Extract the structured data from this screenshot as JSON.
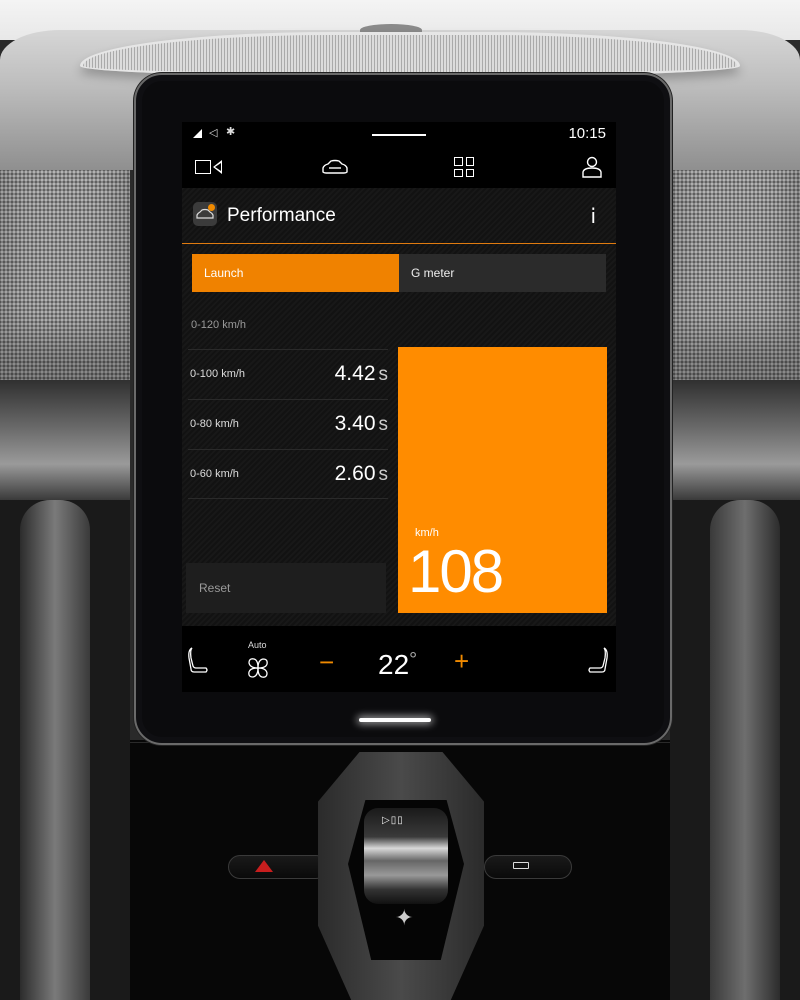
{
  "status_bar": {
    "icons": [
      "signal-icon",
      "navigation-arrow-icon",
      "bluetooth-icon"
    ],
    "nav_arrow_glyph": "◁",
    "bluetooth_glyph": "✱",
    "time": "10:15"
  },
  "top_nav": {
    "items": [
      {
        "name": "camera",
        "icon": "camera-icon"
      },
      {
        "name": "car",
        "icon": "car-icon"
      },
      {
        "name": "apps",
        "icon": "app-grid-icon"
      },
      {
        "name": "profile",
        "icon": "profile-icon"
      }
    ]
  },
  "header": {
    "title": "Performance",
    "app_icon": "performance-car-icon",
    "info_label": "i"
  },
  "tabs": [
    {
      "label": "Launch",
      "active": true
    },
    {
      "label": "G meter",
      "active": false
    }
  ],
  "launch": {
    "section_label": "0-120 km/h",
    "rows": [
      {
        "label": "0-100 km/h",
        "value": "4.42",
        "unit": "s"
      },
      {
        "label": "0-80 km/h",
        "value": "3.40",
        "unit": "s"
      },
      {
        "label": "0-60 km/h",
        "value": "2.60",
        "unit": "s"
      }
    ],
    "reset_label": "Reset",
    "speed": {
      "unit": "km/h",
      "value": "108"
    }
  },
  "climate": {
    "fan_mode": "Auto",
    "minus_label": "−",
    "plus_label": "+",
    "temperature": "22",
    "degree_symbol": "°"
  },
  "console": {
    "gear_indicator": "▷▯▯",
    "logo_glyph": "✦"
  },
  "colors": {
    "accent": "#f08200",
    "speed_panel": "#ff8c00",
    "background": "#121212",
    "tab_inactive": "#2b2b2b"
  }
}
